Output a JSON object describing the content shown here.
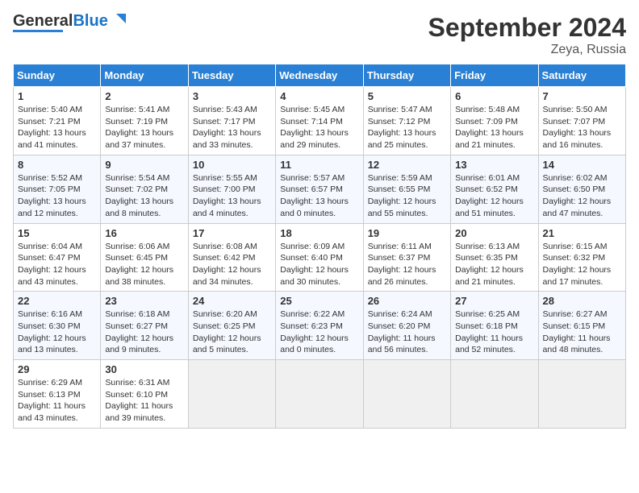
{
  "header": {
    "logo_general": "General",
    "logo_blue": "Blue",
    "title": "September 2024",
    "subtitle": "Zeya, Russia"
  },
  "calendar": {
    "weekdays": [
      "Sunday",
      "Monday",
      "Tuesday",
      "Wednesday",
      "Thursday",
      "Friday",
      "Saturday"
    ],
    "weeks": [
      [
        {
          "day": "1",
          "info": "Sunrise: 5:40 AM\nSunset: 7:21 PM\nDaylight: 13 hours\nand 41 minutes."
        },
        {
          "day": "2",
          "info": "Sunrise: 5:41 AM\nSunset: 7:19 PM\nDaylight: 13 hours\nand 37 minutes."
        },
        {
          "day": "3",
          "info": "Sunrise: 5:43 AM\nSunset: 7:17 PM\nDaylight: 13 hours\nand 33 minutes."
        },
        {
          "day": "4",
          "info": "Sunrise: 5:45 AM\nSunset: 7:14 PM\nDaylight: 13 hours\nand 29 minutes."
        },
        {
          "day": "5",
          "info": "Sunrise: 5:47 AM\nSunset: 7:12 PM\nDaylight: 13 hours\nand 25 minutes."
        },
        {
          "day": "6",
          "info": "Sunrise: 5:48 AM\nSunset: 7:09 PM\nDaylight: 13 hours\nand 21 minutes."
        },
        {
          "day": "7",
          "info": "Sunrise: 5:50 AM\nSunset: 7:07 PM\nDaylight: 13 hours\nand 16 minutes."
        }
      ],
      [
        {
          "day": "8",
          "info": "Sunrise: 5:52 AM\nSunset: 7:05 PM\nDaylight: 13 hours\nand 12 minutes."
        },
        {
          "day": "9",
          "info": "Sunrise: 5:54 AM\nSunset: 7:02 PM\nDaylight: 13 hours\nand 8 minutes."
        },
        {
          "day": "10",
          "info": "Sunrise: 5:55 AM\nSunset: 7:00 PM\nDaylight: 13 hours\nand 4 minutes."
        },
        {
          "day": "11",
          "info": "Sunrise: 5:57 AM\nSunset: 6:57 PM\nDaylight: 13 hours\nand 0 minutes."
        },
        {
          "day": "12",
          "info": "Sunrise: 5:59 AM\nSunset: 6:55 PM\nDaylight: 12 hours\nand 55 minutes."
        },
        {
          "day": "13",
          "info": "Sunrise: 6:01 AM\nSunset: 6:52 PM\nDaylight: 12 hours\nand 51 minutes."
        },
        {
          "day": "14",
          "info": "Sunrise: 6:02 AM\nSunset: 6:50 PM\nDaylight: 12 hours\nand 47 minutes."
        }
      ],
      [
        {
          "day": "15",
          "info": "Sunrise: 6:04 AM\nSunset: 6:47 PM\nDaylight: 12 hours\nand 43 minutes."
        },
        {
          "day": "16",
          "info": "Sunrise: 6:06 AM\nSunset: 6:45 PM\nDaylight: 12 hours\nand 38 minutes."
        },
        {
          "day": "17",
          "info": "Sunrise: 6:08 AM\nSunset: 6:42 PM\nDaylight: 12 hours\nand 34 minutes."
        },
        {
          "day": "18",
          "info": "Sunrise: 6:09 AM\nSunset: 6:40 PM\nDaylight: 12 hours\nand 30 minutes."
        },
        {
          "day": "19",
          "info": "Sunrise: 6:11 AM\nSunset: 6:37 PM\nDaylight: 12 hours\nand 26 minutes."
        },
        {
          "day": "20",
          "info": "Sunrise: 6:13 AM\nSunset: 6:35 PM\nDaylight: 12 hours\nand 21 minutes."
        },
        {
          "day": "21",
          "info": "Sunrise: 6:15 AM\nSunset: 6:32 PM\nDaylight: 12 hours\nand 17 minutes."
        }
      ],
      [
        {
          "day": "22",
          "info": "Sunrise: 6:16 AM\nSunset: 6:30 PM\nDaylight: 12 hours\nand 13 minutes."
        },
        {
          "day": "23",
          "info": "Sunrise: 6:18 AM\nSunset: 6:27 PM\nDaylight: 12 hours\nand 9 minutes."
        },
        {
          "day": "24",
          "info": "Sunrise: 6:20 AM\nSunset: 6:25 PM\nDaylight: 12 hours\nand 5 minutes."
        },
        {
          "day": "25",
          "info": "Sunrise: 6:22 AM\nSunset: 6:23 PM\nDaylight: 12 hours\nand 0 minutes."
        },
        {
          "day": "26",
          "info": "Sunrise: 6:24 AM\nSunset: 6:20 PM\nDaylight: 11 hours\nand 56 minutes."
        },
        {
          "day": "27",
          "info": "Sunrise: 6:25 AM\nSunset: 6:18 PM\nDaylight: 11 hours\nand 52 minutes."
        },
        {
          "day": "28",
          "info": "Sunrise: 6:27 AM\nSunset: 6:15 PM\nDaylight: 11 hours\nand 48 minutes."
        }
      ],
      [
        {
          "day": "29",
          "info": "Sunrise: 6:29 AM\nSunset: 6:13 PM\nDaylight: 11 hours\nand 43 minutes."
        },
        {
          "day": "30",
          "info": "Sunrise: 6:31 AM\nSunset: 6:10 PM\nDaylight: 11 hours\nand 39 minutes."
        },
        {
          "day": "",
          "info": ""
        },
        {
          "day": "",
          "info": ""
        },
        {
          "day": "",
          "info": ""
        },
        {
          "day": "",
          "info": ""
        },
        {
          "day": "",
          "info": ""
        }
      ]
    ]
  }
}
